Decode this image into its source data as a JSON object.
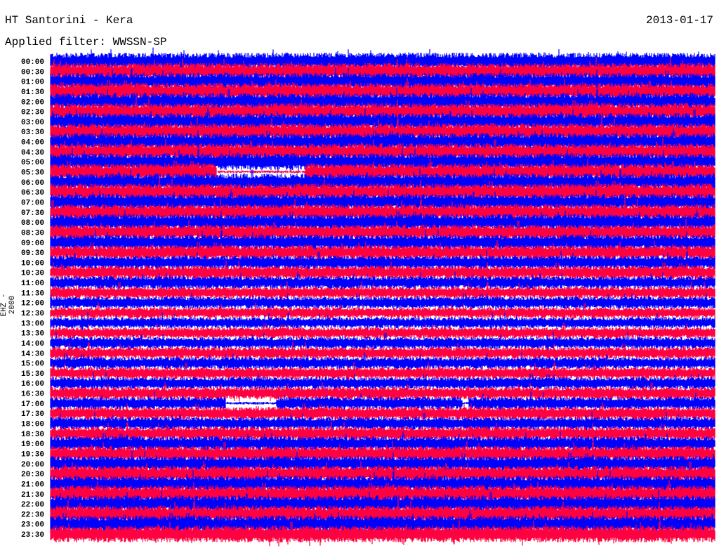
{
  "chart_data": {
    "type": "line",
    "title": "HT Santorini - Kera",
    "date": "2013-01-17",
    "filter": "Applied filter: WWSSN-SP",
    "ylabel": "EHZ - 2000",
    "row_minutes": 30,
    "colors": [
      "#0000ff",
      "#ff0040"
    ],
    "rows": [
      "00:00",
      "00:30",
      "01:00",
      "01:30",
      "02:00",
      "02:30",
      "03:00",
      "03:30",
      "04:00",
      "04:30",
      "05:00",
      "05:30",
      "06:00",
      "06:30",
      "07:00",
      "07:30",
      "08:00",
      "08:30",
      "09:00",
      "09:30",
      "10:00",
      "10:30",
      "11:00",
      "11:30",
      "12:00",
      "12:30",
      "13:00",
      "13:30",
      "14:00",
      "14:30",
      "15:00",
      "15:30",
      "16:00",
      "16:30",
      "17:00",
      "17:30",
      "18:00",
      "18:30",
      "19:00",
      "19:30",
      "20:00",
      "20:30",
      "21:00",
      "21:30",
      "22:00",
      "22:30",
      "23:00",
      "23:30"
    ],
    "noise_level": [
      1.0,
      1.0,
      1.0,
      1.0,
      1.0,
      1.0,
      1.0,
      1.0,
      1.0,
      1.0,
      1.0,
      1.0,
      1.0,
      1.0,
      0.95,
      0.95,
      0.95,
      0.9,
      0.9,
      0.85,
      0.8,
      0.8,
      0.75,
      0.7,
      0.7,
      0.65,
      0.65,
      0.65,
      0.7,
      0.7,
      0.7,
      0.7,
      0.7,
      0.75,
      0.75,
      0.75,
      0.75,
      0.8,
      0.85,
      0.9,
      0.9,
      0.95,
      0.95,
      1.0,
      1.0,
      1.0,
      1.0,
      1.0
    ],
    "gaps": [
      {
        "row": "05:30",
        "start_min": 7.5,
        "end_min": 11.5
      },
      {
        "row": "17:00",
        "start_min": 7.9,
        "end_min": 10.2
      },
      {
        "row": "17:00",
        "start_min": 18.6,
        "end_min": 18.9
      }
    ]
  }
}
